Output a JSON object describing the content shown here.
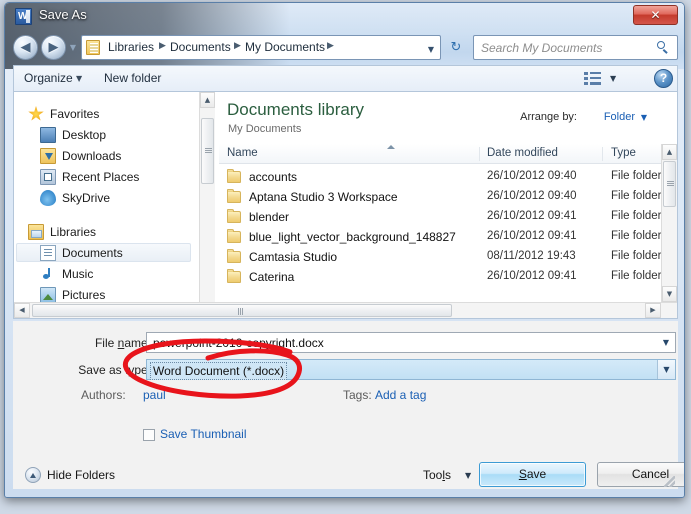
{
  "window": {
    "title": "Save As",
    "app_icon": "word-icon",
    "close_label": "✕"
  },
  "address_bar": {
    "back_arrow": "◀",
    "forward_arrow": "▶",
    "history_chevron": "▼",
    "crumbs": [
      "Libraries",
      "Documents",
      "My Documents"
    ],
    "separator": "▶",
    "dropdown_chevron": "▼",
    "refresh_icon": "↻"
  },
  "search": {
    "placeholder": "Search My Documents",
    "icon": "search-icon"
  },
  "toolbar": {
    "organize_label": "Organize",
    "organize_chevron": "▼",
    "new_folder_label": "New folder",
    "view_chevron": "▼",
    "help_label": "?"
  },
  "navpane": {
    "items": [
      {
        "label": "Favorites",
        "icon": "star-icon",
        "level": 0,
        "selected": false
      },
      {
        "label": "Desktop",
        "icon": "desktop-icon",
        "level": 1,
        "selected": false
      },
      {
        "label": "Downloads",
        "icon": "download-icon",
        "level": 1,
        "selected": false
      },
      {
        "label": "Recent Places",
        "icon": "recent-icon",
        "level": 1,
        "selected": false
      },
      {
        "label": "SkyDrive",
        "icon": "cloud-icon",
        "level": 1,
        "selected": false
      },
      {
        "label": "Libraries",
        "icon": "library-icon",
        "level": 0,
        "selected": false
      },
      {
        "label": "Documents",
        "icon": "document-icon",
        "level": 1,
        "selected": true
      },
      {
        "label": "Music",
        "icon": "music-icon",
        "level": 1,
        "selected": false
      },
      {
        "label": "Pictures",
        "icon": "picture-icon",
        "level": 1,
        "selected": false
      }
    ],
    "scroll_up": "▲",
    "scroll_down": "▼"
  },
  "listpane": {
    "library_title": "Documents library",
    "library_subtitle": "My Documents",
    "arrange_label": "Arrange by:",
    "arrange_value": "Folder",
    "arrange_chevron": "▼",
    "columns": [
      "Name",
      "Date modified",
      "Type"
    ],
    "rows": [
      {
        "name": "accounts",
        "date": "26/10/2012 09:40",
        "type": "File folder"
      },
      {
        "name": "Aptana Studio 3 Workspace",
        "date": "26/10/2012 09:40",
        "type": "File folder"
      },
      {
        "name": "blender",
        "date": "26/10/2012 09:41",
        "type": "File folder"
      },
      {
        "name": "blue_light_vector_background_148827",
        "date": "26/10/2012 09:41",
        "type": "File folder"
      },
      {
        "name": "Camtasia Studio",
        "date": "08/11/2012 19:43",
        "type": "File folder"
      },
      {
        "name": "Caterina",
        "date": "26/10/2012 09:41",
        "type": "File folder"
      }
    ],
    "scroll_up": "▲",
    "scroll_down": "▼",
    "scroll_left": "◀",
    "scroll_right": "▶"
  },
  "form": {
    "file_name_label": "File name:",
    "file_name_value": "powerpoint-2010-copyright.docx",
    "save_as_type_label": "Save as type:",
    "save_as_type_value": "Word Document (*.docx)",
    "authors_label": "Authors:",
    "authors_value": "paul",
    "tags_label": "Tags:",
    "tags_value": "Add a tag",
    "save_thumbnail_label": "Save Thumbnail",
    "save_thumbnail_checked": false
  },
  "actions": {
    "hide_folders_label": "Hide Folders",
    "tools_label": "Tools",
    "tools_chevron": "▼",
    "save_label": "Save",
    "cancel_label": "Cancel"
  },
  "annotation": {
    "shape": "red-ellipse",
    "color": "#e8141b",
    "targets": "save-as-type-row"
  },
  "colors": {
    "accent_blue": "#1a5fb4",
    "library_green": "#2b5e3f",
    "close_red": "#c43b2c",
    "annotation_red": "#e8141b"
  }
}
